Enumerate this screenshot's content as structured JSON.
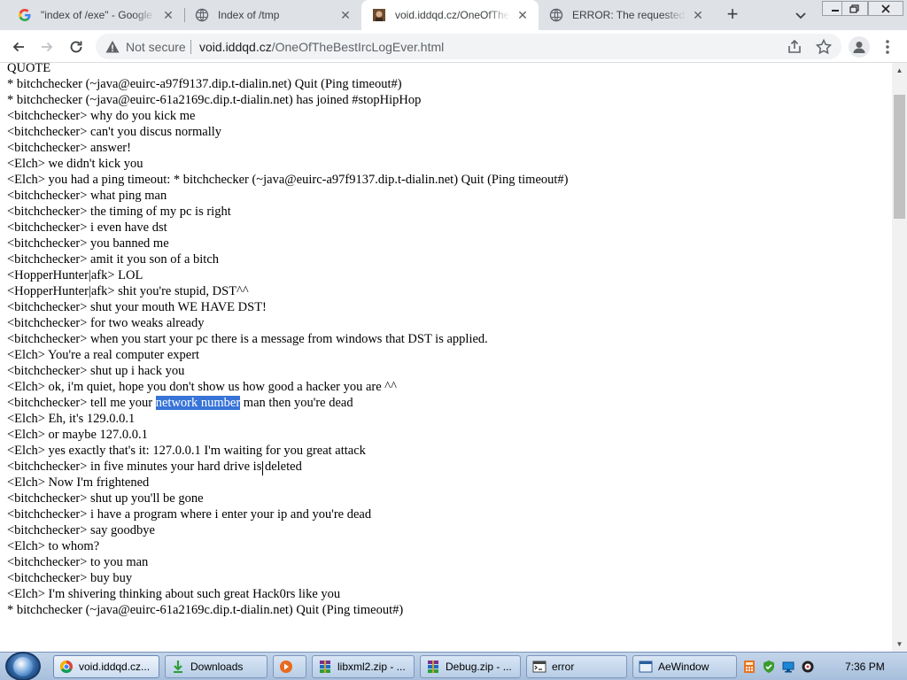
{
  "browser": {
    "tabs": [
      {
        "title": "\"index of /exe\" - Google Search",
        "favicon": "google-g-icon",
        "active": false
      },
      {
        "title": "Index of /tmp",
        "favicon": "globe-icon",
        "active": false
      },
      {
        "title": "void.iddqd.cz/OneOfTheBestIrcLogEver.html",
        "favicon": "page-photo-icon",
        "active": true
      },
      {
        "title": "ERROR: The requested URL could not be retrieved",
        "favicon": "globe-icon",
        "active": false
      }
    ],
    "new_tab_label": "+",
    "address": {
      "security_label": "Not secure",
      "domain": "void.iddqd.cz",
      "path": "/OneOfTheBestIrcLogEver.html"
    },
    "icons": {
      "back": "arrow-left-icon",
      "forward": "arrow-right-icon",
      "reload": "reload-icon",
      "warning": "warning-triangle-icon",
      "share": "share-icon",
      "bookmark": "star-icon",
      "profile": "profile-icon",
      "menu": "kebab-menu-icon"
    },
    "window_controls": [
      "minimize-icon",
      "restore-icon",
      "close-icon"
    ]
  },
  "page": {
    "lines": [
      "QUOTE",
      "* bitchchecker (~java@euirc-a97f9137.dip.t-dialin.net) Quit (Ping timeout#)",
      "* bitchchecker (~java@euirc-61a2169c.dip.t-dialin.net) has joined #stopHipHop",
      "<bitchchecker> why do you kick me",
      "<bitchchecker> can't you discus normally",
      "<bitchchecker> answer!",
      "<Elch> we didn't kick you",
      "<Elch> you had a ping timeout: * bitchchecker (~java@euirc-a97f9137.dip.t-dialin.net) Quit (Ping timeout#)",
      "<bitchchecker> what ping man",
      "<bitchchecker> the timing of my pc is right",
      "<bitchchecker> i even have dst",
      "<bitchchecker> you banned me",
      "<bitchchecker> amit it you son of a bitch",
      "<HopperHunter|afk> LOL",
      "<HopperHunter|afk> shit you're stupid, DST^^",
      "<bitchchecker> shut your mouth WE HAVE DST!",
      "<bitchchecker> for two weaks already",
      "<bitchchecker> when you start your pc there is a message from windows that DST is applied.",
      "<Elch> You're a real computer expert",
      "<bitchchecker> shut up i hack you",
      "<Elch> ok, i'm quiet, hope you don't show us how good a hacker you are ^^",
      "<bitchchecker> tell me your network number man then you're dead",
      "<Elch> Eh, it's 129.0.0.1",
      "<Elch> or maybe 127.0.0.1",
      "<Elch> yes exactly that's it: 127.0.0.1 I'm waiting for you great attack",
      "<bitchchecker> in five minutes your hard drive is deleted",
      "<Elch> Now I'm frightened",
      "<bitchchecker> shut up you'll be gone",
      "<bitchchecker> i have a program where i enter your ip and you're dead",
      "<bitchchecker> say goodbye",
      "<Elch> to whom?",
      "<bitchchecker> to you man",
      "<bitchchecker> buy buy",
      "<Elch> I'm shivering thinking about such great Hack0rs like you",
      "* bitchchecker (~java@euirc-61a2169c.dip.t-dialin.net) Quit (Ping timeout#)"
    ],
    "selection": {
      "line_index": 21,
      "before": "<bitchchecker> tell me your ",
      "selected": "network number",
      "after": " man then you're dead"
    }
  },
  "taskbar": {
    "tasks": [
      {
        "label": "void.iddqd.cz...",
        "icon": "chrome-icon",
        "active": true
      },
      {
        "label": "Downloads",
        "icon": "download-icon",
        "active": false
      },
      {
        "label": "",
        "icon": "media-player-icon",
        "active": false
      },
      {
        "label": "libxml2.zip - ...",
        "icon": "winrar-icon",
        "active": false
      },
      {
        "label": "Debug.zip - ...",
        "icon": "winrar-icon",
        "active": false
      },
      {
        "label": "error",
        "icon": "terminal-icon",
        "active": false
      },
      {
        "label": "AeWindow",
        "icon": "app-window-icon",
        "active": false
      }
    ],
    "tray_icons": [
      "calculator-icon",
      "security-check-icon",
      "network-icon",
      "monitor-icon",
      "volume-icon"
    ],
    "clock": "7:36 PM"
  },
  "colors": {
    "tabstrip": "#dee1e6",
    "selection": "#3874d8",
    "taskbar": "#b8cde6"
  }
}
